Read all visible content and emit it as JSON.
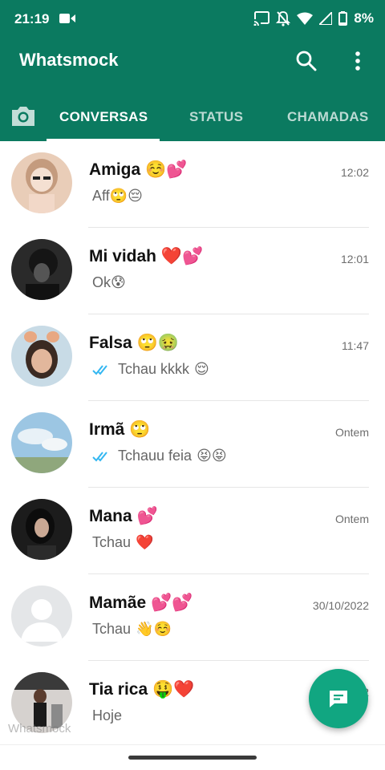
{
  "status_bar": {
    "time": "21:19",
    "battery": "8%",
    "icons": [
      "video-record-icon",
      "cast-icon",
      "notifications-off-icon",
      "wifi-icon",
      "signal-icon",
      "battery-icon"
    ]
  },
  "app_bar": {
    "title": "Whatsmock",
    "color": "#0b7a60"
  },
  "tabs": [
    {
      "label": "CONVERSAS",
      "active": true
    },
    {
      "label": "STATUS",
      "active": false
    },
    {
      "label": "CHAMADAS",
      "active": false
    }
  ],
  "chats": [
    {
      "name": "Amiga",
      "name_emoji": "☺️💕",
      "time": "12:02",
      "message": "Aff",
      "message_emoji": "🙄😔",
      "ticks": false
    },
    {
      "name": "Mi vidah",
      "name_emoji": "❤️💕",
      "time": "12:01",
      "message": "Ok",
      "message_emoji": "😰",
      "ticks": false
    },
    {
      "name": "Falsa",
      "name_emoji": "🙄🤢",
      "time": "11:47",
      "message": "Tchau kkkk",
      "message_emoji": "😌",
      "ticks": true
    },
    {
      "name": "Irmã",
      "name_emoji": "🙄",
      "time": "Ontem",
      "message": "Tchauu feia",
      "message_emoji": "😝😝",
      "ticks": true
    },
    {
      "name": "Mana",
      "name_emoji": "💕",
      "time": "Ontem",
      "message": "Tchau",
      "message_emoji": "❤️",
      "ticks": false
    },
    {
      "name": "Mamãe",
      "name_emoji": "💕💕",
      "time": "30/10/2022",
      "message": "Tchau",
      "message_emoji": "👋☺️",
      "ticks": false
    },
    {
      "name": "Tia rica",
      "name_emoji": "🤑❤️",
      "time": "2",
      "message": "Hoje",
      "message_emoji": "",
      "ticks": false
    }
  ],
  "watermark": "Whatsmock",
  "fab": {
    "icon": "new-chat-icon",
    "color": "#11a681"
  },
  "tick_color": "#34b7f1"
}
